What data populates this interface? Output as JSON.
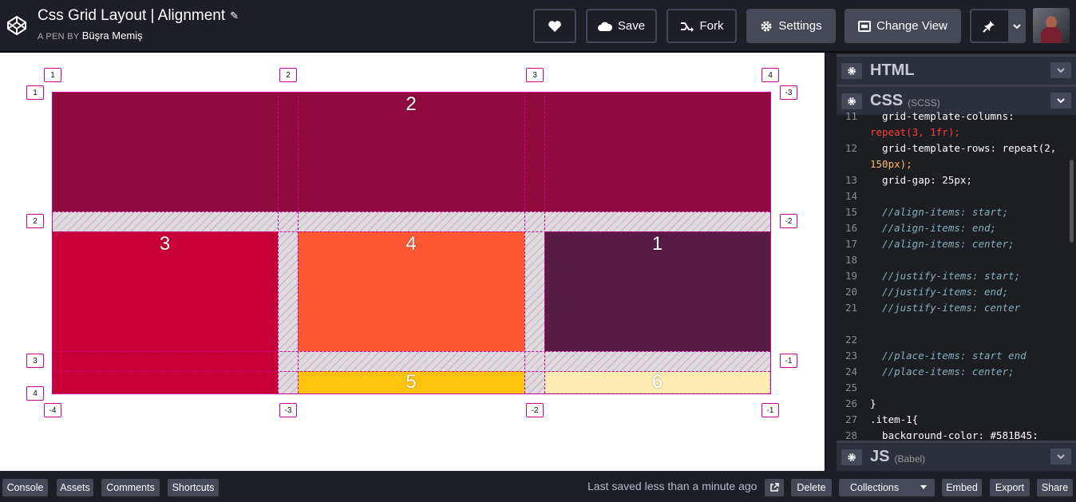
{
  "header": {
    "title": "Css Grid Layout | Alignment",
    "byline_prefix": "A PEN BY",
    "author": "Büşra Memiş",
    "buttons": {
      "save": "Save",
      "fork": "Fork",
      "settings": "Settings",
      "change_view": "Change View"
    }
  },
  "preview": {
    "items": [
      "2",
      "3",
      "4",
      "1",
      "5",
      "6"
    ],
    "colors": {
      "item2": "#8f0b3d",
      "item3": "#c80038",
      "item4": "#fe5733",
      "item1": "#581b45",
      "item5": "#ffc30e",
      "item6": "#feedb3"
    },
    "top_tags": [
      "1",
      "2",
      "3",
      "4"
    ],
    "bottom_tags": [
      "-4",
      "-3",
      "-2",
      "-1"
    ],
    "left_tags": [
      "1",
      "2",
      "3",
      "4"
    ],
    "right_tags": [
      "-3",
      "-2",
      "-1"
    ]
  },
  "panels": {
    "html": {
      "name": "HTML"
    },
    "css": {
      "name": "CSS",
      "sub": "(SCSS)"
    },
    "js": {
      "name": "JS",
      "sub": "(Babel)"
    }
  },
  "code_lines": [
    {
      "n": "11",
      "t": "  grid-template-columns:"
    },
    {
      "n": "",
      "t": "repeat(3, 1fr);"
    },
    {
      "n": "12",
      "t": "  grid-template-rows: repeat(2,"
    },
    {
      "n": "",
      "t": "150px);"
    },
    {
      "n": "13",
      "t": "  grid-gap: 25px;"
    },
    {
      "n": "14",
      "t": ""
    },
    {
      "n": "15",
      "t": "  //align-items: start;"
    },
    {
      "n": "16",
      "t": "  //align-items: end;"
    },
    {
      "n": "17",
      "t": "  //align-items: center;"
    },
    {
      "n": "18",
      "t": ""
    },
    {
      "n": "19",
      "t": "  //justify-items: start;"
    },
    {
      "n": "20",
      "t": "  //justify-items: end;"
    },
    {
      "n": "21",
      "t": "  //justify-items: center"
    },
    {
      "n": "",
      "t": ""
    },
    {
      "n": "22",
      "t": ""
    },
    {
      "n": "23",
      "t": "  //place-items: start end"
    },
    {
      "n": "24",
      "t": "  //place-items: center;"
    },
    {
      "n": "25",
      "t": ""
    },
    {
      "n": "26",
      "t": "}"
    },
    {
      "n": "27",
      "t": ".item-1{"
    },
    {
      "n": "28",
      "t": "  background-color: #581B45;"
    }
  ],
  "footer": {
    "console": "Console",
    "assets": "Assets",
    "comments": "Comments",
    "shortcuts": "Shortcuts",
    "saved_status": "Last saved less than a minute ago",
    "delete": "Delete",
    "collections": "Collections",
    "embed": "Embed",
    "export": "Export",
    "share": "Share"
  }
}
